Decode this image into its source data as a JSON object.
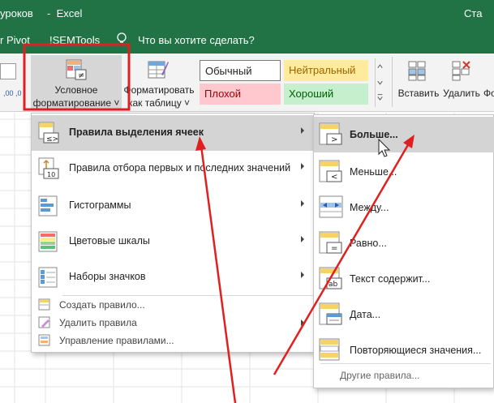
{
  "titlebar": {
    "doc": "уроков",
    "dash": "-",
    "app": "Excel",
    "right": "Ста"
  },
  "tellbar": {
    "tab1": "r Pivot",
    "tab2": "!SEMTools",
    "search_placeholder": "Что вы хотите сделать?"
  },
  "ribbon": {
    "cond_format": {
      "line1": "Условное",
      "line2": "форматирование ˅"
    },
    "format_table": {
      "line1": "Форматировать",
      "line2": "как таблицу ˅"
    },
    "styles": {
      "normal": "Обычный",
      "neutral": "Нейтральный",
      "bad": "Плохой",
      "good": "Хороший"
    },
    "insert": "Вставить",
    "delete": "Удалить",
    "format_cut": "Фо",
    "mini_label": ",00 ,0"
  },
  "menu": {
    "items": [
      {
        "label": "Правила выделения ячеек",
        "icon": "highlight-rules-icon",
        "highlighted": true
      },
      {
        "label": "Правила отбора первых и последних значений",
        "icon": "top-bottom-rules-icon"
      },
      {
        "label": "Гистограммы",
        "icon": "data-bars-icon"
      },
      {
        "label": "Цветовые шкалы",
        "icon": "color-scales-icon"
      },
      {
        "label": "Наборы значков",
        "icon": "icon-sets-icon"
      }
    ],
    "small": [
      {
        "label": "Создать правило...",
        "icon": "new-rule-icon"
      },
      {
        "label": "Удалить правила",
        "icon": "clear-rules-icon"
      },
      {
        "label": "Управление правилами...",
        "icon": "manage-rules-icon"
      }
    ]
  },
  "submenu": {
    "items": [
      {
        "label": "Больше...",
        "icon": "greater-than-icon",
        "highlighted": true
      },
      {
        "label": "Меньше...",
        "icon": "less-than-icon"
      },
      {
        "label": "Между...",
        "icon": "between-icon"
      },
      {
        "label": "Равно...",
        "icon": "equal-to-icon"
      },
      {
        "label": "Текст содержит...",
        "icon": "text-contains-icon"
      },
      {
        "label": "Дата...",
        "icon": "date-occurring-icon"
      },
      {
        "label": "Повторяющиеся значения...",
        "icon": "duplicate-values-icon"
      }
    ],
    "more": "Другие правила..."
  },
  "colors": {
    "excel_green": "#217346",
    "highlight_box": "#e02020",
    "annotation_arrow": "#e02020",
    "menu_highlight": "#d4d4d4"
  }
}
